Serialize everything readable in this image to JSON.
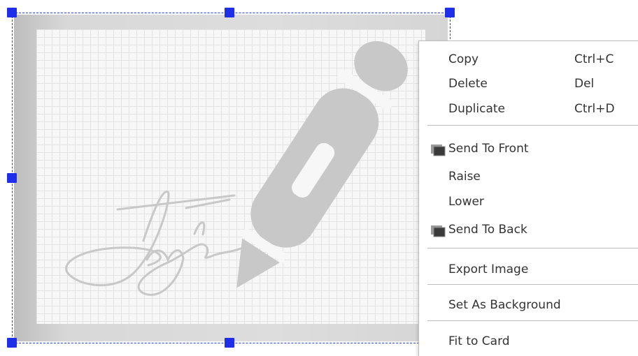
{
  "colors": {
    "selection_handle": "#1f2ee8",
    "selection_border": "#2b3fd4",
    "menu_text": "#333333",
    "menu_separator": "#bdbdbd",
    "artwork_gray": "#c8c8c8"
  },
  "canvas": {
    "image_description_icon": "signature-pen-icon"
  },
  "context_menu": {
    "items": [
      {
        "label": "Copy",
        "shortcut": "Ctrl+C"
      },
      {
        "label": "Delete",
        "shortcut": "Del"
      },
      {
        "label": "Duplicate",
        "shortcut": "Ctrl+D"
      },
      {
        "label": "Send To Front",
        "icon": "layer-front-icon"
      },
      {
        "label": "Raise"
      },
      {
        "label": "Lower"
      },
      {
        "label": "Send To Back",
        "icon": "layer-back-icon"
      },
      {
        "label": "Export Image"
      },
      {
        "label": "Set As Background"
      },
      {
        "label": "Fit to Card"
      }
    ]
  }
}
